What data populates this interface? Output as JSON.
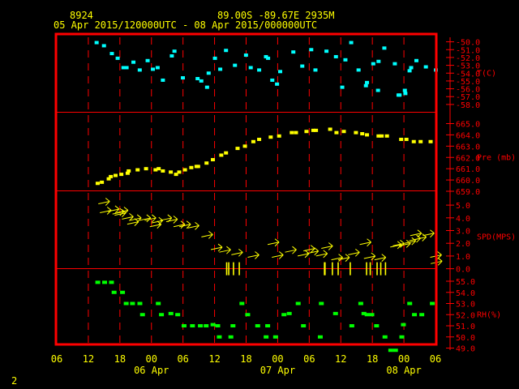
{
  "header": {
    "station_id": "8924",
    "location": "89.00S   -89.67E   2935M",
    "period": "05 Apr 2015/120000UTC - 08 Apr 2015/000000UTC"
  },
  "footer": {
    "page_number": "2"
  },
  "colors": {
    "background": "#000000",
    "frame": "#ff0000",
    "grid": "#ff0000",
    "time_text": "#ffff00",
    "header_text": "#ffff00",
    "temperature": "#00ffff",
    "pressure": "#ffff00",
    "wind": "#ffff00",
    "humidity": "#00ff00",
    "axis_labels": "#ff0000"
  },
  "chart_data": {
    "type": "scatter",
    "x_axis": {
      "units": "hours from 05 Apr 2015 06 UTC",
      "range": [
        0,
        72
      ],
      "tick_labels": [
        "06",
        "12",
        "18",
        "00",
        "06",
        "12",
        "18",
        "00",
        "06",
        "12",
        "18",
        "00",
        "06"
      ],
      "date_labels": [
        {
          "label": "06 Apr",
          "at_hour": 18
        },
        {
          "label": "07 Apr",
          "at_hour": 42
        },
        {
          "label": "08 Apr",
          "at_hour": 66
        }
      ]
    },
    "panels": [
      {
        "name": "T(C)",
        "ylim": [
          -58.0,
          -50.0
        ],
        "tick_labels": [
          "-50.0",
          "-51.0",
          "-52.0",
          "-53.0",
          "-54.0",
          "-55.0",
          "-56.0",
          "-57.0",
          "-58.0"
        ],
        "points": [
          [
            7.5,
            -50.1
          ],
          [
            8.9,
            -50.5
          ],
          [
            10.4,
            -51.5
          ],
          [
            11.5,
            -52.1
          ],
          [
            12.6,
            -53.3
          ],
          [
            13.2,
            -53.3
          ],
          [
            14.5,
            -52.6
          ],
          [
            15.7,
            -53.6
          ],
          [
            17.2,
            -52.4
          ],
          [
            18.2,
            -53.5
          ],
          [
            19.1,
            -53.3
          ],
          [
            20.1,
            -54.9
          ],
          [
            21.8,
            -51.8
          ],
          [
            22.3,
            -51.2
          ],
          [
            23.9,
            -54.6
          ],
          [
            26.7,
            -54.7
          ],
          [
            27.4,
            -55.0
          ],
          [
            28.5,
            -55.8
          ],
          [
            28.8,
            -54.0
          ],
          [
            30.0,
            -52.1
          ],
          [
            31.0,
            -53.5
          ],
          [
            32.1,
            -51.1
          ],
          [
            33.8,
            -53.0
          ],
          [
            35.9,
            -51.7
          ],
          [
            36.8,
            -53.3
          ],
          [
            38.4,
            -53.6
          ],
          [
            39.7,
            -51.9
          ],
          [
            40.1,
            -52.1
          ],
          [
            40.9,
            -54.9
          ],
          [
            41.8,
            -55.4
          ],
          [
            42.4,
            -53.8
          ],
          [
            44.9,
            -51.3
          ],
          [
            46.6,
            -53.1
          ],
          [
            48.3,
            -51.0
          ],
          [
            49.1,
            -53.6
          ],
          [
            51.2,
            -51.2
          ],
          [
            53.0,
            -51.9
          ],
          [
            54.2,
            -55.8
          ],
          [
            54.8,
            -52.3
          ],
          [
            55.9,
            -50.1
          ],
          [
            57.3,
            -53.6
          ],
          [
            58.7,
            -55.6
          ],
          [
            58.9,
            -55.2
          ],
          [
            60.1,
            -52.8
          ],
          [
            61.0,
            -56.2
          ],
          [
            61.1,
            -52.5
          ],
          [
            62.2,
            -50.8
          ],
          [
            64.2,
            -52.8
          ],
          [
            64.9,
            -56.8
          ],
          [
            65.1,
            -56.8
          ],
          [
            66.1,
            -56.2
          ],
          [
            66.2,
            -56.6
          ],
          [
            67.0,
            -53.7
          ],
          [
            67.3,
            -53.3
          ],
          [
            68.3,
            -52.4
          ],
          [
            70.1,
            -53.2
          ],
          [
            72.0,
            -53.6
          ]
        ]
      },
      {
        "name": "Pre (mb)",
        "ylim": [
          659.0,
          665.0
        ],
        "tick_labels": [
          "665.0",
          "664.0",
          "663.0",
          "662.0",
          "661.0",
          "660.0",
          "659.0"
        ],
        "points": [
          [
            7.7,
            659.7
          ],
          [
            8.5,
            659.8
          ],
          [
            9.8,
            660.1
          ],
          [
            10.2,
            660.3
          ],
          [
            11.1,
            660.4
          ],
          [
            12.2,
            660.5
          ],
          [
            13.4,
            660.6
          ],
          [
            13.6,
            660.8
          ],
          [
            15.3,
            660.9
          ],
          [
            16.9,
            661.0
          ],
          [
            18.7,
            660.9
          ],
          [
            19.3,
            661.0
          ],
          [
            20.1,
            660.8
          ],
          [
            21.6,
            660.7
          ],
          [
            22.6,
            660.5
          ],
          [
            23.2,
            660.7
          ],
          [
            24.3,
            660.9
          ],
          [
            25.5,
            661.1
          ],
          [
            26.5,
            661.2
          ],
          [
            26.8,
            661.2
          ],
          [
            28.4,
            661.5
          ],
          [
            29.6,
            661.8
          ],
          [
            31.2,
            662.2
          ],
          [
            32.1,
            662.4
          ],
          [
            34.3,
            662.8
          ],
          [
            35.7,
            663.0
          ],
          [
            37.3,
            663.4
          ],
          [
            38.4,
            663.6
          ],
          [
            40.6,
            663.8
          ],
          [
            42.2,
            663.9
          ],
          [
            44.6,
            664.2
          ],
          [
            45.4,
            664.2
          ],
          [
            47.4,
            664.3
          ],
          [
            48.7,
            664.4
          ],
          [
            49.2,
            664.4
          ],
          [
            51.9,
            664.5
          ],
          [
            53.1,
            664.2
          ],
          [
            54.5,
            664.3
          ],
          [
            56.8,
            664.2
          ],
          [
            58.0,
            664.1
          ],
          [
            58.9,
            664.0
          ],
          [
            61.1,
            663.9
          ],
          [
            61.7,
            663.9
          ],
          [
            62.7,
            663.9
          ],
          [
            65.4,
            663.6
          ],
          [
            66.4,
            663.6
          ],
          [
            67.8,
            663.4
          ],
          [
            69.1,
            663.4
          ],
          [
            71.0,
            663.4
          ]
        ]
      },
      {
        "name": "SPD(MPS)",
        "ylim": [
          0.0,
          5.0
        ],
        "tick_labels": [
          "5.0",
          "4.0",
          "3.0",
          "2.0",
          "1.0",
          "0.0"
        ],
        "tick_marks": [
          [
            32.3,
            0.0
          ],
          [
            32.7,
            0.0
          ],
          [
            33.6,
            0.0
          ],
          [
            34.7,
            0.0
          ],
          [
            50.9,
            0.0
          ],
          [
            51.0,
            0.0
          ],
          [
            52.4,
            0.0
          ],
          [
            53.5,
            0.0
          ],
          [
            55.8,
            0.0
          ],
          [
            58.9,
            0.0
          ],
          [
            59.6,
            0.0
          ],
          [
            60.9,
            0.0
          ],
          [
            61.6,
            0.0
          ],
          [
            62.5,
            0.0
          ]
        ],
        "arrows": [
          [
            7.9,
            5.1
          ],
          [
            8.2,
            4.4
          ],
          [
            9.7,
            4.5
          ],
          [
            10.6,
            4.3
          ],
          [
            11.0,
            4.2
          ],
          [
            11.4,
            4.4
          ],
          [
            12.4,
            3.9
          ],
          [
            13.4,
            3.5
          ],
          [
            13.9,
            3.8
          ],
          [
            15.7,
            3.8
          ],
          [
            16.7,
            3.8
          ],
          [
            17.7,
            3.3
          ],
          [
            18.0,
            3.6
          ],
          [
            19.7,
            3.8
          ],
          [
            20.8,
            3.7
          ],
          [
            22.2,
            3.3
          ],
          [
            23.3,
            3.3
          ],
          [
            24.9,
            3.2
          ],
          [
            27.5,
            2.5
          ],
          [
            29.3,
            1.5
          ],
          [
            30.9,
            1.3
          ],
          [
            33.2,
            1.1
          ],
          [
            36.3,
            0.9
          ],
          [
            40.1,
            1.9
          ],
          [
            40.9,
            0.9
          ],
          [
            43.4,
            1.3
          ],
          [
            45.8,
            1.0
          ],
          [
            46.9,
            1.4
          ],
          [
            47.6,
            1.2
          ],
          [
            49.3,
            1.0
          ],
          [
            50.3,
            1.6
          ],
          [
            52.2,
            0.7
          ],
          [
            53.5,
            0.7
          ],
          [
            55.4,
            1.1
          ],
          [
            57.6,
            1.9
          ],
          [
            58.4,
            0.8
          ],
          [
            60.4,
            0.7
          ],
          [
            63.4,
            1.7
          ],
          [
            63.9,
            1.8
          ],
          [
            65.1,
            1.8
          ],
          [
            66.1,
            2.0
          ],
          [
            67.0,
            2.2
          ],
          [
            67.2,
            2.6
          ],
          [
            68.1,
            2.3
          ],
          [
            69.6,
            2.6
          ],
          [
            71.0,
            0.9
          ],
          [
            71.1,
            0.4
          ]
        ]
      },
      {
        "name": "RH(%)",
        "ylim": [
          49.0,
          55.0
        ],
        "tick_labels": [
          "55.0",
          "54.0",
          "53.0",
          "52.0",
          "51.0",
          "50.0",
          "49.0"
        ],
        "points": [
          [
            7.8,
            54.9
          ],
          [
            9.1,
            54.9
          ],
          [
            10.4,
            54.9
          ],
          [
            10.9,
            54.0
          ],
          [
            12.5,
            54.0
          ],
          [
            13.2,
            53.0
          ],
          [
            14.4,
            53.0
          ],
          [
            15.8,
            53.0
          ],
          [
            16.3,
            52.0
          ],
          [
            19.3,
            53.0
          ],
          [
            19.9,
            52.0
          ],
          [
            21.7,
            52.1
          ],
          [
            23.0,
            52.0
          ],
          [
            24.2,
            51.0
          ],
          [
            25.8,
            51.0
          ],
          [
            27.3,
            51.0
          ],
          [
            28.4,
            51.0
          ],
          [
            29.7,
            51.1
          ],
          [
            30.6,
            51.0
          ],
          [
            30.9,
            50.0
          ],
          [
            33.1,
            50.0
          ],
          [
            33.5,
            51.0
          ],
          [
            35.2,
            53.0
          ],
          [
            36.3,
            52.0
          ],
          [
            38.2,
            51.0
          ],
          [
            39.8,
            50.0
          ],
          [
            40.1,
            51.0
          ],
          [
            41.6,
            50.0
          ],
          [
            43.2,
            52.0
          ],
          [
            44.2,
            52.1
          ],
          [
            45.9,
            53.0
          ],
          [
            46.9,
            51.0
          ],
          [
            50.1,
            50.0
          ],
          [
            50.3,
            53.0
          ],
          [
            53.0,
            52.1
          ],
          [
            56.1,
            51.0
          ],
          [
            57.8,
            53.0
          ],
          [
            58.4,
            52.1
          ],
          [
            59.0,
            52.0
          ],
          [
            59.9,
            52.0
          ],
          [
            60.8,
            51.0
          ],
          [
            62.4,
            50.0
          ],
          [
            63.5,
            48.8
          ],
          [
            64.4,
            48.8
          ],
          [
            65.6,
            50.0
          ],
          [
            65.9,
            51.1
          ],
          [
            67.1,
            53.0
          ],
          [
            68.0,
            52.0
          ],
          [
            69.4,
            52.0
          ],
          [
            71.4,
            53.0
          ]
        ]
      }
    ]
  }
}
